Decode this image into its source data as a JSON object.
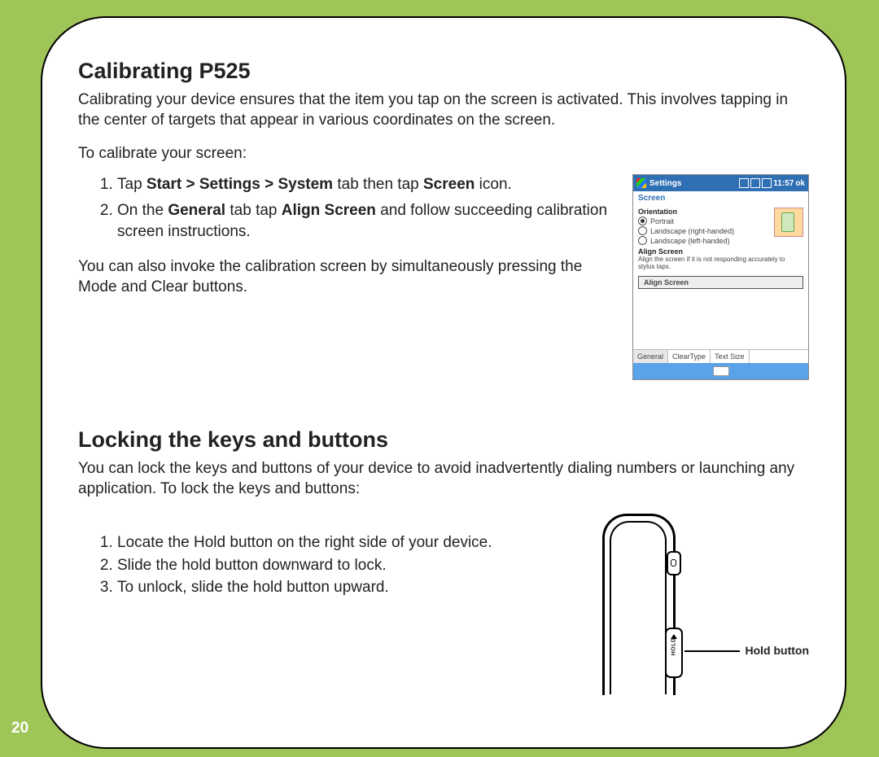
{
  "page_number": "20",
  "section1": {
    "heading": "Calibrating P525",
    "intro": "Calibrating your device ensures that the item you tap on the screen is activated. This involves tapping in the center of targets that appear in various coordinates on the screen.",
    "lead": "To calibrate your screen:",
    "step1_a": "Tap ",
    "step1_b": "Start > Settings > System",
    "step1_c": " tab then tap ",
    "step1_d": "Screen",
    "step1_e": " icon.",
    "step2_a": "On the ",
    "step2_b": "General",
    "step2_c": " tab tap ",
    "step2_d": "Align Screen",
    "step2_e": " and follow succeeding calibration screen instructions.",
    "note": "You can also invoke the calibration screen by simultaneously pressing the Mode and Clear buttons."
  },
  "screenshot": {
    "titlebar": "Settings",
    "time": "11:57",
    "ok": "ok",
    "subtitle": "Screen",
    "orientation_heading": "Orientation",
    "opt_portrait": "Portrait",
    "opt_land_r": "Landscape (right-handed)",
    "opt_land_l": "Landscape (left-handed)",
    "align_heading": "Align Screen",
    "align_desc": "Align the screen if it is not responding accurately to stylus taps.",
    "align_button": "Align Screen",
    "tab_general": "General",
    "tab_cleartype": "ClearType",
    "tab_textsize": "Text Size"
  },
  "section2": {
    "heading": "Locking the keys and buttons",
    "intro": "You can lock the keys and buttons of your device to avoid inadvertently dialing numbers or launching any application. To lock the keys and buttons:",
    "step1": "Locate the Hold button on the right side of your device.",
    "step2": "Slide the hold button downward to lock.",
    "step3": "To unlock, slide the hold button upward.",
    "hold_button_label": "Hold button",
    "hold_text": "HOLD"
  }
}
